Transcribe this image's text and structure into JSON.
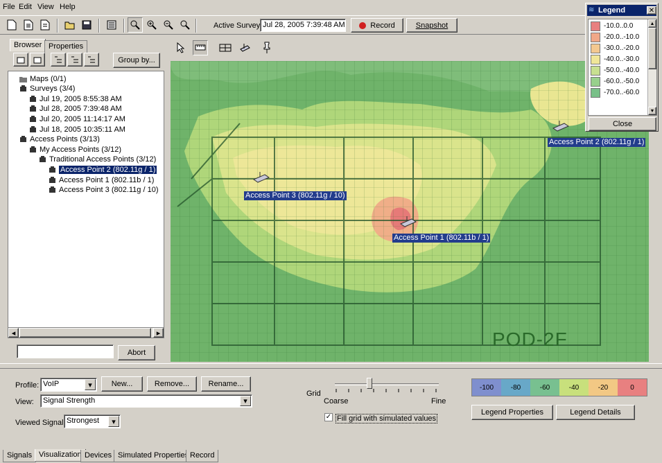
{
  "menu": {
    "file": "File",
    "edit": "Edit",
    "view": "View",
    "help": "Help"
  },
  "toolbar": {
    "active_survey_label": "Active Survey:",
    "active_survey_value": "Jul 28, 2005 7:39:48 AM",
    "record_label": "Record",
    "snapshot_label": "Snapshot"
  },
  "left_tabs": {
    "browser": "Browser",
    "properties": "Properties"
  },
  "group_by_label": "Group by...",
  "tree": [
    {
      "label": "Maps  (0/1)",
      "level": 0,
      "icon": "folder-icon"
    },
    {
      "label": "Surveys  (3/4)",
      "level": 0,
      "icon": "survey-group-icon"
    },
    {
      "label": "Jul 19, 2005 8:55:38 AM",
      "level": 1,
      "icon": "survey-icon"
    },
    {
      "label": "Jul 28, 2005 7:39:48 AM",
      "level": 1,
      "icon": "survey-icon"
    },
    {
      "label": "Jul 20, 2005 11:14:17 AM",
      "level": 1,
      "icon": "survey-icon"
    },
    {
      "label": "Jul 18, 2005 10:35:11 AM",
      "level": 1,
      "icon": "survey-icon"
    },
    {
      "label": "Access Points  (3/13)",
      "level": 0,
      "icon": "access-point-group-icon"
    },
    {
      "label": "My Access Points  (3/12)",
      "level": 1,
      "icon": "access-point-group-icon"
    },
    {
      "label": "Traditional Access Points  (3/12)",
      "level": 2,
      "icon": "access-point-group-icon"
    },
    {
      "label": "Access Point 2 (802.11g / 1)",
      "level": 3,
      "icon": "access-point-icon",
      "selected": true
    },
    {
      "label": "Access Point 1 (802.11b / 1)",
      "level": 3,
      "icon": "access-point-icon"
    },
    {
      "label": "Access Point 3 (802.11g / 10)",
      "level": 3,
      "icon": "access-point-icon"
    }
  ],
  "abort_label": "Abort",
  "map": {
    "floor_label": "POD-2F",
    "ap_labels": {
      "ap1": "Access Point 1 (802.11b / 1)",
      "ap2": "Access Point 2 (802.11g / 1)",
      "ap3": "Access Point 3 (802.11g / 10)"
    }
  },
  "legend": {
    "title": "Legend",
    "close_label": "Close",
    "entries": [
      {
        "label": "-10.0..0.0",
        "color": "#e88080"
      },
      {
        "label": "-20.0..-10.0",
        "color": "#f0a888"
      },
      {
        "label": "-30.0..-20.0",
        "color": "#f3c890"
      },
      {
        "label": "-40.0..-30.0",
        "color": "#f0e698"
      },
      {
        "label": "-50.0..-40.0",
        "color": "#c8e090"
      },
      {
        "label": "-60.0..-50.0",
        "color": "#98d08c"
      },
      {
        "label": "-70.0..-60.0",
        "color": "#78c088"
      }
    ]
  },
  "bottom": {
    "profile_label": "Profile:",
    "profile_value": "VoIP",
    "new_label": "New...",
    "remove_label": "Remove...",
    "rename_label": "Rename...",
    "view_label": "View:",
    "view_value": "Signal Strength",
    "viewed_signal_label": "Viewed Signal",
    "viewed_signal_value": "Strongest",
    "grid_label": "Grid",
    "coarse_label": "Coarse",
    "fine_label": "Fine",
    "fill_grid_label": "Fill grid with simulated values",
    "fill_grid_checked": true,
    "legend_properties_label": "Legend Properties",
    "legend_details_label": "Legend Details"
  },
  "scale": [
    {
      "label": "-100",
      "color": "#7f8fce"
    },
    {
      "label": "-80",
      "color": "#68a8c8"
    },
    {
      "label": "-60",
      "color": "#78c090"
    },
    {
      "label": "-40",
      "color": "#c8e07c"
    },
    {
      "label": "-20",
      "color": "#f2c884"
    },
    {
      "label": "0",
      "color": "#e88080"
    }
  ],
  "bottom_tabs": [
    "Signals",
    "Visualization",
    "Devices",
    "Simulated Properties",
    "Record"
  ],
  "active_bottom_tab": "Visualization"
}
